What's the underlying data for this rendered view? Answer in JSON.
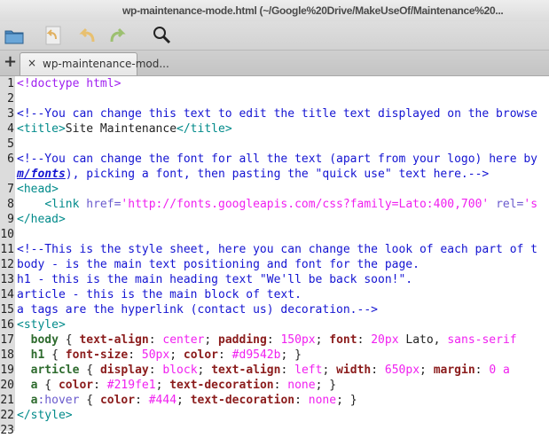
{
  "window": {
    "title": "wp-maintenance-mode.html (~/Google%20Drive/MakeUseOf/Maintenance%20..."
  },
  "toolbar": {
    "icons": [
      "folder-icon",
      "revert-icon",
      "undo-icon",
      "redo-icon",
      "search-icon"
    ]
  },
  "tabs": {
    "new_tab": "+",
    "close": "×",
    "active_label": "wp-maintenance-mod..."
  },
  "colors": {
    "comment": "#1414d2",
    "tag": "#008a8a",
    "string": "#f020f0",
    "property": "#8b1c1c",
    "selector": "#2e6b2e",
    "doctype": "#a020f0"
  },
  "editor": {
    "lines": [
      {
        "n": "1",
        "segs": [
          [
            "doctype",
            "<!doctype html>"
          ]
        ]
      },
      {
        "n": "2",
        "segs": []
      },
      {
        "n": "3",
        "segs": [
          [
            "comment",
            "<!--You can change this text to edit the title text displayed on the browse"
          ]
        ]
      },
      {
        "n": "4",
        "segs": [
          [
            "tag",
            "<title>"
          ],
          [
            "text",
            "Site Maintenance"
          ],
          [
            "tag",
            "</title>"
          ]
        ]
      },
      {
        "n": "5",
        "segs": []
      },
      {
        "n": "6",
        "segs": [
          [
            "comment",
            "<!--You can change the font for all the text (apart from your logo) here by "
          ]
        ]
      },
      {
        "n": "",
        "segs": [
          [
            "link",
            "m/fonts"
          ],
          [
            "comment",
            "), picking a font, then pasting the \"quick use\" text here.-->"
          ]
        ]
      },
      {
        "n": "7",
        "segs": [
          [
            "tag",
            "<head>"
          ]
        ]
      },
      {
        "n": "8",
        "segs": [
          [
            "text",
            "    "
          ],
          [
            "tag",
            "<link "
          ],
          [
            "attr",
            "href="
          ],
          [
            "string",
            "'http://fonts.googleapis.com/css?family=Lato:400,700'"
          ],
          [
            "text",
            " "
          ],
          [
            "attr",
            "rel="
          ],
          [
            "string",
            "'s"
          ]
        ]
      },
      {
        "n": "9",
        "segs": [
          [
            "tag",
            "</head>"
          ]
        ]
      },
      {
        "n": "10",
        "segs": []
      },
      {
        "n": "11",
        "segs": [
          [
            "comment",
            "<!--This is the style sheet, here you can change the look of each part of t"
          ]
        ]
      },
      {
        "n": "12",
        "segs": [
          [
            "comment",
            "body - is the main text positioning and font for the page."
          ]
        ]
      },
      {
        "n": "13",
        "segs": [
          [
            "comment",
            "h1 - this is the main heading text \"We'll be back soon!\"."
          ]
        ]
      },
      {
        "n": "14",
        "segs": [
          [
            "comment",
            "article - this is the main block of text."
          ]
        ]
      },
      {
        "n": "15",
        "segs": [
          [
            "comment",
            "a tags are the hyperlink (contact us) decoration.-->"
          ]
        ]
      },
      {
        "n": "16",
        "segs": [
          [
            "tag",
            "<style>"
          ]
        ]
      },
      {
        "n": "17",
        "segs": [
          [
            "text",
            "  "
          ],
          [
            "sel",
            "body"
          ],
          [
            "punct",
            " { "
          ],
          [
            "prop",
            "text-align"
          ],
          [
            "punct",
            ": "
          ],
          [
            "val",
            "center"
          ],
          [
            "punct",
            "; "
          ],
          [
            "prop",
            "padding"
          ],
          [
            "punct",
            ": "
          ],
          [
            "val",
            "150px"
          ],
          [
            "punct",
            "; "
          ],
          [
            "prop",
            "font"
          ],
          [
            "punct",
            ": "
          ],
          [
            "val",
            "20px"
          ],
          [
            "text",
            " Lato, "
          ],
          [
            "val",
            "sans-serif"
          ]
        ]
      },
      {
        "n": "18",
        "segs": [
          [
            "text",
            "  "
          ],
          [
            "sel",
            "h1"
          ],
          [
            "punct",
            " { "
          ],
          [
            "prop",
            "font-size"
          ],
          [
            "punct",
            ": "
          ],
          [
            "val",
            "50px"
          ],
          [
            "punct",
            "; "
          ],
          [
            "prop",
            "color"
          ],
          [
            "punct",
            ": "
          ],
          [
            "val",
            "#d9542b"
          ],
          [
            "punct",
            "; }"
          ]
        ]
      },
      {
        "n": "19",
        "segs": [
          [
            "text",
            "  "
          ],
          [
            "sel",
            "article"
          ],
          [
            "punct",
            " { "
          ],
          [
            "prop",
            "display"
          ],
          [
            "punct",
            ": "
          ],
          [
            "val",
            "block"
          ],
          [
            "punct",
            "; "
          ],
          [
            "prop",
            "text-align"
          ],
          [
            "punct",
            ": "
          ],
          [
            "val",
            "left"
          ],
          [
            "punct",
            "; "
          ],
          [
            "prop",
            "width"
          ],
          [
            "punct",
            ": "
          ],
          [
            "val",
            "650px"
          ],
          [
            "punct",
            "; "
          ],
          [
            "prop",
            "margin"
          ],
          [
            "punct",
            ": "
          ],
          [
            "val",
            "0 a"
          ]
        ]
      },
      {
        "n": "20",
        "segs": [
          [
            "text",
            "  "
          ],
          [
            "sel",
            "a"
          ],
          [
            "punct",
            " { "
          ],
          [
            "prop",
            "color"
          ],
          [
            "punct",
            ": "
          ],
          [
            "val",
            "#219fe1"
          ],
          [
            "punct",
            "; "
          ],
          [
            "prop",
            "text-decoration"
          ],
          [
            "punct",
            ": "
          ],
          [
            "val",
            "none"
          ],
          [
            "punct",
            "; }"
          ]
        ]
      },
      {
        "n": "21",
        "segs": [
          [
            "text",
            "  "
          ],
          [
            "sel",
            "a"
          ],
          [
            "attr",
            ":hover"
          ],
          [
            "punct",
            " { "
          ],
          [
            "prop",
            "color"
          ],
          [
            "punct",
            ": "
          ],
          [
            "val",
            "#444"
          ],
          [
            "punct",
            "; "
          ],
          [
            "prop",
            "text-decoration"
          ],
          [
            "punct",
            ": "
          ],
          [
            "val",
            "none"
          ],
          [
            "punct",
            "; }"
          ]
        ]
      },
      {
        "n": "22",
        "segs": [
          [
            "tag",
            "</style>"
          ]
        ]
      },
      {
        "n": "23",
        "segs": []
      }
    ]
  }
}
